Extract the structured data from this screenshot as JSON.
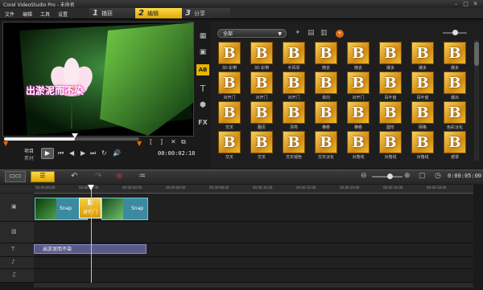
{
  "app": {
    "title": "Corel VideoStudio Pro - 未命名"
  },
  "menu": [
    "文件",
    "编辑",
    "工具",
    "设置"
  ],
  "steps": [
    {
      "num": "1",
      "label": "捕获"
    },
    {
      "num": "2",
      "label": "编辑"
    },
    {
      "num": "3",
      "label": "分享"
    }
  ],
  "preview": {
    "caption": "出淤泥而不染",
    "project_label": "项目",
    "clip_label": "素材",
    "timecode": "00:00:02:18"
  },
  "library": {
    "category": "全部",
    "tile_glyph": "B",
    "rows": [
      [
        "3D 彩带",
        "3D 彩带",
        "手风琴",
        "擦去",
        "擦去",
        "爆多",
        "爆多",
        "爆多"
      ],
      [
        "对开门",
        "对开门",
        "对开门",
        "单向",
        "对开门",
        "百叶窗",
        "百叶窗",
        "爆出"
      ],
      [
        "交叉",
        "翻页",
        "漂亮",
        "横卷",
        "横卷",
        "圆形",
        "网格",
        "色彩淡化"
      ],
      [
        "交叉",
        "交叉",
        "交叉褪色",
        "交叉淡化",
        "对角线",
        "对角线",
        "对角线",
        "遮罩"
      ]
    ],
    "row4_extra": "交叉"
  },
  "timeline": {
    "clip1": "Snap",
    "clip2": "Snap",
    "transition": "对开门",
    "title_clip": "出淤泥而不染",
    "timecode": "0:00:05:00",
    "ruler": [
      "00:00:00:00",
      "00:00:02:00",
      "00:00:04:00",
      "00:00:06:00",
      "00:00:08:00",
      "00:00:10:00",
      "00:00:12:00",
      "00:00:14:00",
      "00:00:16:00",
      "00:00:18:00"
    ]
  },
  "colors": {
    "accent": "#e8b400",
    "clip": "#3a8aa0",
    "title_clip": "#5a5a8a"
  }
}
